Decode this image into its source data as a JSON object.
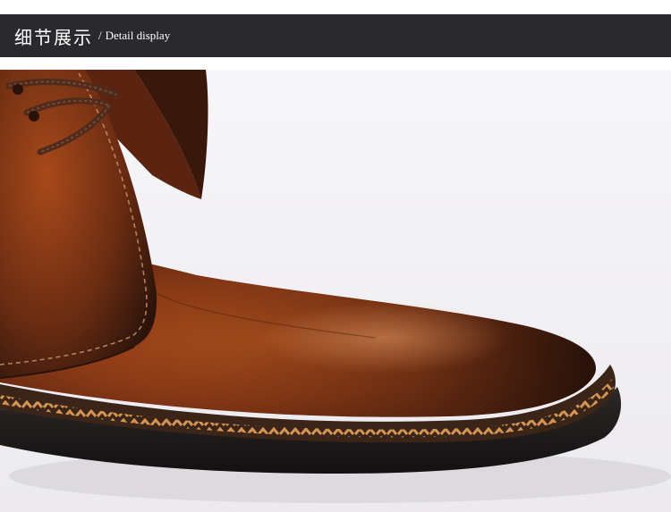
{
  "header": {
    "title_cn": "细节展示",
    "separator": "/",
    "title_en": "Detail display",
    "background": "#2a2a2e",
    "text_color": "#ffffff"
  },
  "photo": {
    "subject": "brown-leather-chukka-boot-toe-closeup",
    "colors": {
      "leather_light": "#b2521f",
      "leather_dark": "#3a1a0e",
      "welt_stitch": "#c98a4a",
      "sole": "#1c1a1a",
      "background": "#f4f3f6"
    }
  }
}
